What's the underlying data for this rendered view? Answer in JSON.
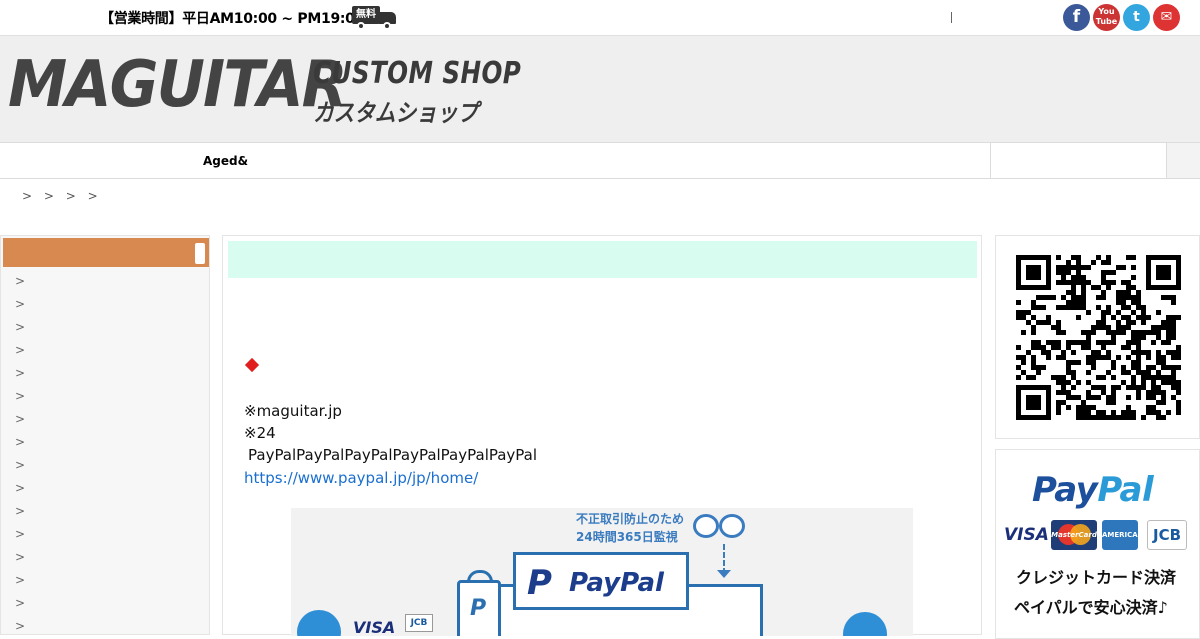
{
  "topbar": {
    "hours": "【営業時間】平日AM10:00 ~ PM19:00",
    "free_badge": "無料",
    "divider": "|",
    "sns": {
      "facebook": "f",
      "youtube": "You Tube",
      "twitter": "t",
      "mail": "✉"
    },
    "colors": {
      "facebook": "#3b5998",
      "youtube": "#cc3333",
      "twitter": "#33a6e0",
      "mail": "#dd3333"
    }
  },
  "header": {
    "logo_main": "MAGUITAR",
    "logo_sub1": "CUSTOM SHOP",
    "logo_sub2": "カスタムショップ"
  },
  "nav": {
    "items": [
      {
        "label": ""
      },
      {
        "label": ""
      },
      {
        "label": ""
      },
      {
        "label": "Aged&"
      }
    ]
  },
  "breadcrumb": "> > > >",
  "sidebar": {
    "accent_color": "#d8894f",
    "arrows": [
      ">",
      ">",
      ">",
      ">",
      ">",
      ">",
      ">",
      ">",
      ">",
      ">",
      ">",
      ">",
      ">",
      ">",
      ">",
      ">"
    ]
  },
  "main": {
    "band_color": "#d9fcf1",
    "lines": [
      "※maguitar.jp",
      "※24",
      "PayPalPayPalPayPalPayPalPayPalPayPal"
    ],
    "link": "https://www.paypal.jp/jp/home/",
    "illustration": {
      "caption_line1": "不正取引防止のため",
      "caption_line2": "24時間365日監視",
      "logo_p": "P",
      "logo_text": "PayPal",
      "bag_p": "P",
      "visa": "VISA",
      "jcb": "JCB"
    }
  },
  "right": {
    "paypal_logo_pay": "Pay",
    "paypal_logo_pal": "Pal",
    "cards": {
      "visa": "VISA",
      "mastercard": "MasterCard",
      "amex": "AMERICAN EXPRESS",
      "jcb": "JCB"
    },
    "line1": "クレジットカード決済",
    "line2": "ペイパルで安心決済♪"
  }
}
